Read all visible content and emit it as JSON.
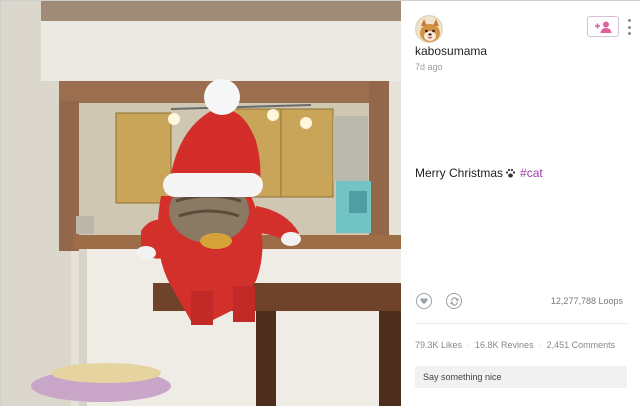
{
  "post": {
    "username": "kabosumama",
    "time_ago": "7d ago",
    "caption_text": "Merry Christmas",
    "hashtag": "#cat",
    "loops": "12,277,788 Loops",
    "likes": "79.3K Likes",
    "revines": "16.8K Revines",
    "comments": "2,451 Comments",
    "separator": "·",
    "comment_placeholder": "Say something nice"
  },
  "icons": {
    "avatar": "shiba-dog-avatar",
    "follow": "add-user-icon",
    "more": "vertical-dots-icon",
    "paw": "paw-icon",
    "like": "heart-icon",
    "revine": "revine-icon"
  },
  "colors": {
    "accent": "#9b3fa8",
    "follow_icon": "#e0609f",
    "text": "#222222",
    "muted": "#888888"
  }
}
